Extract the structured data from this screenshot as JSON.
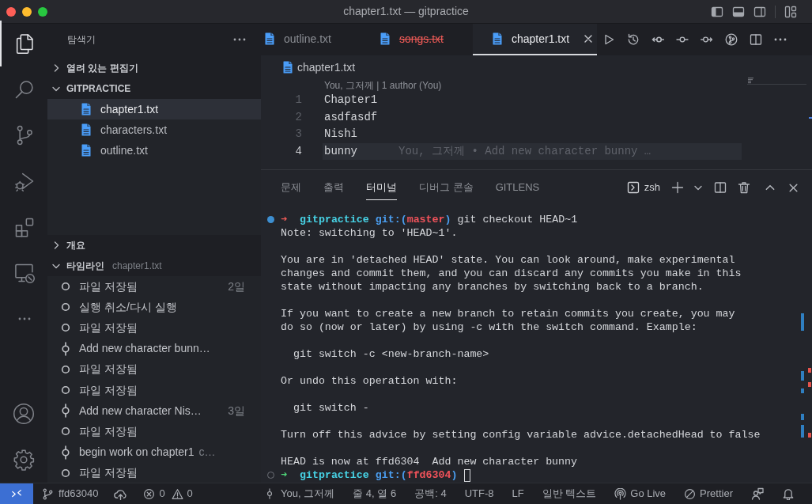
{
  "window": {
    "title": "chapter1.txt — gitpractice"
  },
  "activity_bar": {
    "items": [
      {
        "kind": "explorer",
        "selected": true
      },
      {
        "kind": "search",
        "selected": false
      },
      {
        "kind": "source-control",
        "selected": false
      },
      {
        "kind": "run-debug",
        "selected": false
      },
      {
        "kind": "extensions",
        "selected": false
      },
      {
        "kind": "remote-explorer",
        "selected": false
      },
      {
        "kind": "more",
        "selected": false
      }
    ],
    "bottom": [
      {
        "kind": "accounts"
      },
      {
        "kind": "settings"
      }
    ]
  },
  "sidebar": {
    "title": "탐색기",
    "sections": [
      {
        "title": "열려 있는 편집기",
        "expanded": false
      },
      {
        "kind": "folder",
        "title": "GITPRACTICE",
        "expanded": true,
        "items": [
          {
            "label": "chapter1.txt",
            "selected": true
          },
          {
            "label": "characters.txt",
            "selected": false
          },
          {
            "label": "outline.txt",
            "selected": false
          }
        ]
      },
      {
        "title": "개요",
        "expanded": false
      },
      {
        "kind": "timeline",
        "title": "타임라인",
        "description": "chapter1.txt",
        "expanded": true,
        "items": [
          {
            "kind": "local",
            "label": "파일 저장됨",
            "time": "2일"
          },
          {
            "kind": "local",
            "label": "실행 취소/다시 실행"
          },
          {
            "kind": "local",
            "label": "파일 저장됨"
          },
          {
            "kind": "commit",
            "label": "Add new character bunn…"
          },
          {
            "kind": "local",
            "label": "파일 저장됨"
          },
          {
            "kind": "local",
            "label": "파일 저장됨"
          },
          {
            "kind": "commit",
            "label": "Add new character Nis…",
            "time": "3일"
          },
          {
            "kind": "local",
            "label": "파일 저장됨"
          },
          {
            "kind": "commit",
            "label": "begin work on chapter1",
            "description": "c…"
          },
          {
            "kind": "local",
            "label": "파일 저장됨"
          }
        ]
      }
    ]
  },
  "tabs": [
    {
      "label": "outline.txt",
      "selected": false,
      "deleted": false
    },
    {
      "label": "songs.txt",
      "selected": false,
      "deleted": true
    },
    {
      "label": "chapter1.txt",
      "selected": true,
      "deleted": false
    }
  ],
  "editor": {
    "breadcrumb": "chapter1.txt",
    "codelens": "You, 그저께 | 1 author (You)",
    "lines": [
      {
        "number": "1",
        "text": "Chapter1",
        "current": false
      },
      {
        "number": "2",
        "text": "asdfasdf",
        "current": false
      },
      {
        "number": "3",
        "text": "Nishi",
        "current": false
      },
      {
        "number": "4",
        "text": "bunny",
        "current": true,
        "blame": "You, 그저께 • Add new character bunny …"
      }
    ]
  },
  "panel": {
    "tabs": [
      {
        "label": "문제",
        "selected": false
      },
      {
        "label": "출력",
        "selected": false
      },
      {
        "label": "터미널",
        "selected": true
      },
      {
        "label": "디버그 콘솔",
        "selected": false
      },
      {
        "label": "GITLENS",
        "selected": false
      }
    ],
    "terminal_name": "zsh",
    "lines": [
      {
        "kind": "prompt",
        "finished": true,
        "exit_ok": false,
        "arrow": "➜",
        "directory": "gitpractice",
        "vcs": "git:(",
        "branch": "master",
        "vcs_end": ")",
        "command": "git checkout HEAD~1"
      },
      {
        "kind": "output",
        "text": "Note: switching to 'HEAD~1'."
      },
      {
        "kind": "blank"
      },
      {
        "kind": "output",
        "text": "You are in 'detached HEAD' state. You can look around, make experimental"
      },
      {
        "kind": "output",
        "text": "changes and commit them, and you can discard any commits you make in this"
      },
      {
        "kind": "output",
        "text": "state without impacting any branches by switching back to a branch."
      },
      {
        "kind": "blank"
      },
      {
        "kind": "output",
        "text": "If you want to create a new branch to retain commits you create, you may"
      },
      {
        "kind": "output",
        "text": "do so (now or later) by using -c with the switch command. Example:"
      },
      {
        "kind": "blank"
      },
      {
        "kind": "output",
        "text": "  git switch -c <new-branch-name>"
      },
      {
        "kind": "blank"
      },
      {
        "kind": "output",
        "text": "Or undo this operation with:"
      },
      {
        "kind": "blank"
      },
      {
        "kind": "output",
        "text": "  git switch -"
      },
      {
        "kind": "blank"
      },
      {
        "kind": "output",
        "text": "Turn off this advice by setting config variable advice.detachedHead to false"
      },
      {
        "kind": "blank"
      },
      {
        "kind": "output",
        "text": "HEAD is now at ffd6304  Add new character bunny"
      },
      {
        "kind": "prompt",
        "finished": false,
        "exit_ok": true,
        "arrow": "➜",
        "directory": "gitpractice",
        "vcs": "git:(",
        "branch": "ffd6304",
        "vcs_end": ")",
        "cursor": true
      }
    ]
  },
  "status_bar": {
    "left": [
      {
        "kind": "branch",
        "text": "ffd63040"
      },
      {
        "kind": "publish"
      },
      {
        "kind": "problems",
        "errors": "0",
        "warnings": "0"
      }
    ],
    "right": [
      {
        "kind": "blame",
        "text": "You, 그저께"
      },
      {
        "kind": "text",
        "text": "줄 4, 열 6"
      },
      {
        "kind": "text",
        "text": "공백: 4"
      },
      {
        "kind": "text",
        "text": "UTF-8"
      },
      {
        "kind": "text",
        "text": "LF"
      },
      {
        "kind": "text",
        "text": "일반 텍스트"
      },
      {
        "kind": "golive",
        "text": "Go Live"
      },
      {
        "kind": "prettier",
        "text": "Prettier"
      },
      {
        "kind": "feedback"
      },
      {
        "kind": "notifications"
      }
    ]
  }
}
